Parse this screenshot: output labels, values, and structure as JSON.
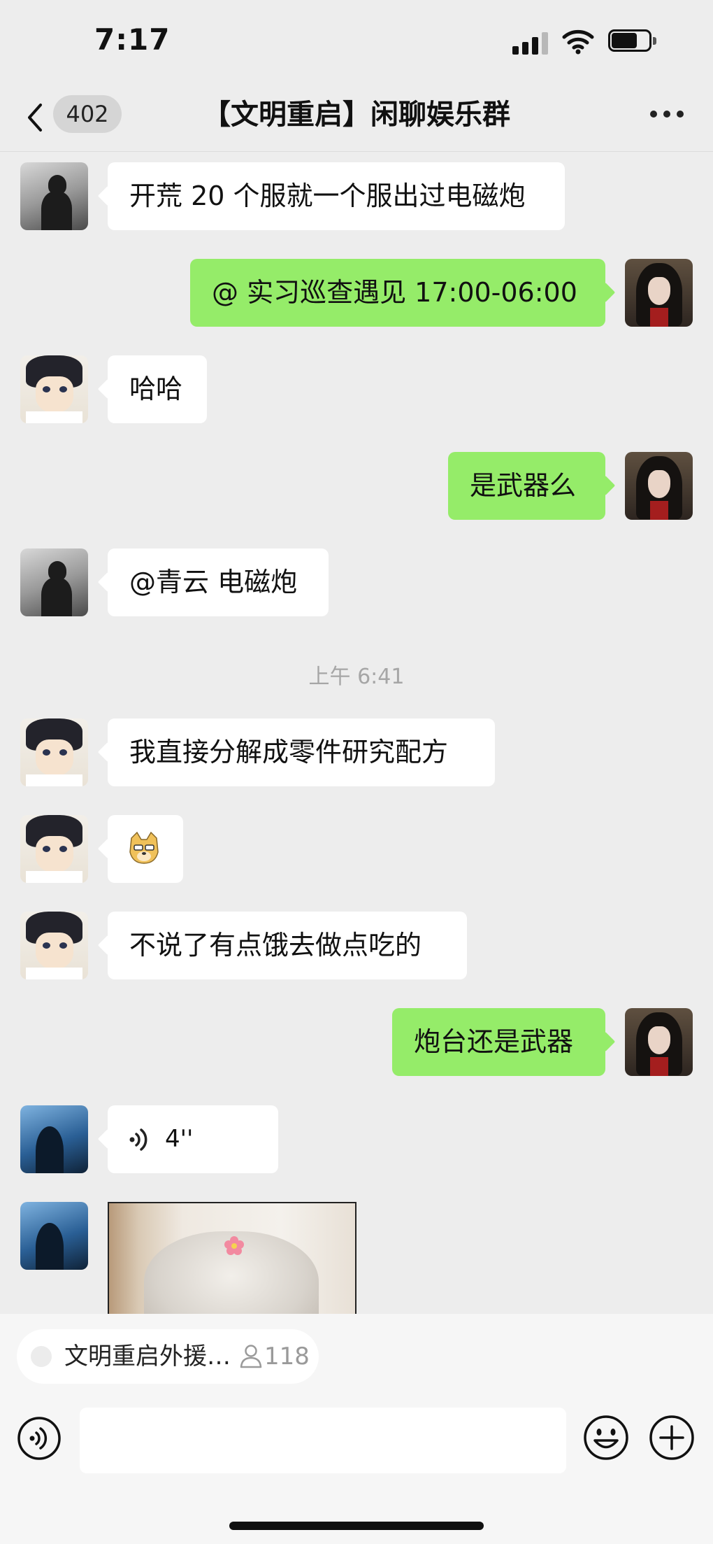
{
  "status_bar": {
    "time": "7:17"
  },
  "nav": {
    "back_badge": "402",
    "title": "【文明重启】闲聊娱乐群"
  },
  "messages": [
    {
      "side": "left",
      "avatar": "silhouette-man-avatar",
      "text": "开荒 20 个服就一个服出过电磁炮"
    },
    {
      "side": "right",
      "avatar": "anime-dark-hair-avatar",
      "text": "@ 实习巡查遇见 17:00-06:00"
    },
    {
      "side": "left",
      "avatar": "anime-boy-avatar",
      "text": "哈哈"
    },
    {
      "side": "right",
      "avatar": "anime-dark-hair-avatar",
      "text": "是武器么"
    },
    {
      "side": "left",
      "avatar": "silhouette-man-avatar",
      "text": "@青云 电磁炮"
    },
    {
      "side": "left",
      "avatar": "anime-boy-avatar",
      "text": "我直接分解成零件研究配方"
    },
    {
      "side": "left",
      "avatar": "anime-boy-avatar",
      "type": "emoji",
      "emoji": "doge-emoji-icon"
    },
    {
      "side": "left",
      "avatar": "anime-boy-avatar",
      "text": "不说了有点饿去做点吃的"
    },
    {
      "side": "right",
      "avatar": "anime-dark-hair-avatar",
      "text": "炮台还是武器"
    },
    {
      "side": "left",
      "avatar": "blue-silhouette-avatar",
      "type": "voice",
      "duration": "4''"
    },
    {
      "side": "left",
      "avatar": "blue-silhouette-avatar",
      "type": "image",
      "image": "cat-with-flower-image"
    }
  ],
  "timestamp": "上午 6:41",
  "pinned": {
    "title": "文明重启外援…",
    "count": "118"
  },
  "colors": {
    "background": "#ededed",
    "own_bubble": "#95ec69",
    "other_bubble": "#ffffff",
    "timestamp": "#a6a6a6"
  }
}
